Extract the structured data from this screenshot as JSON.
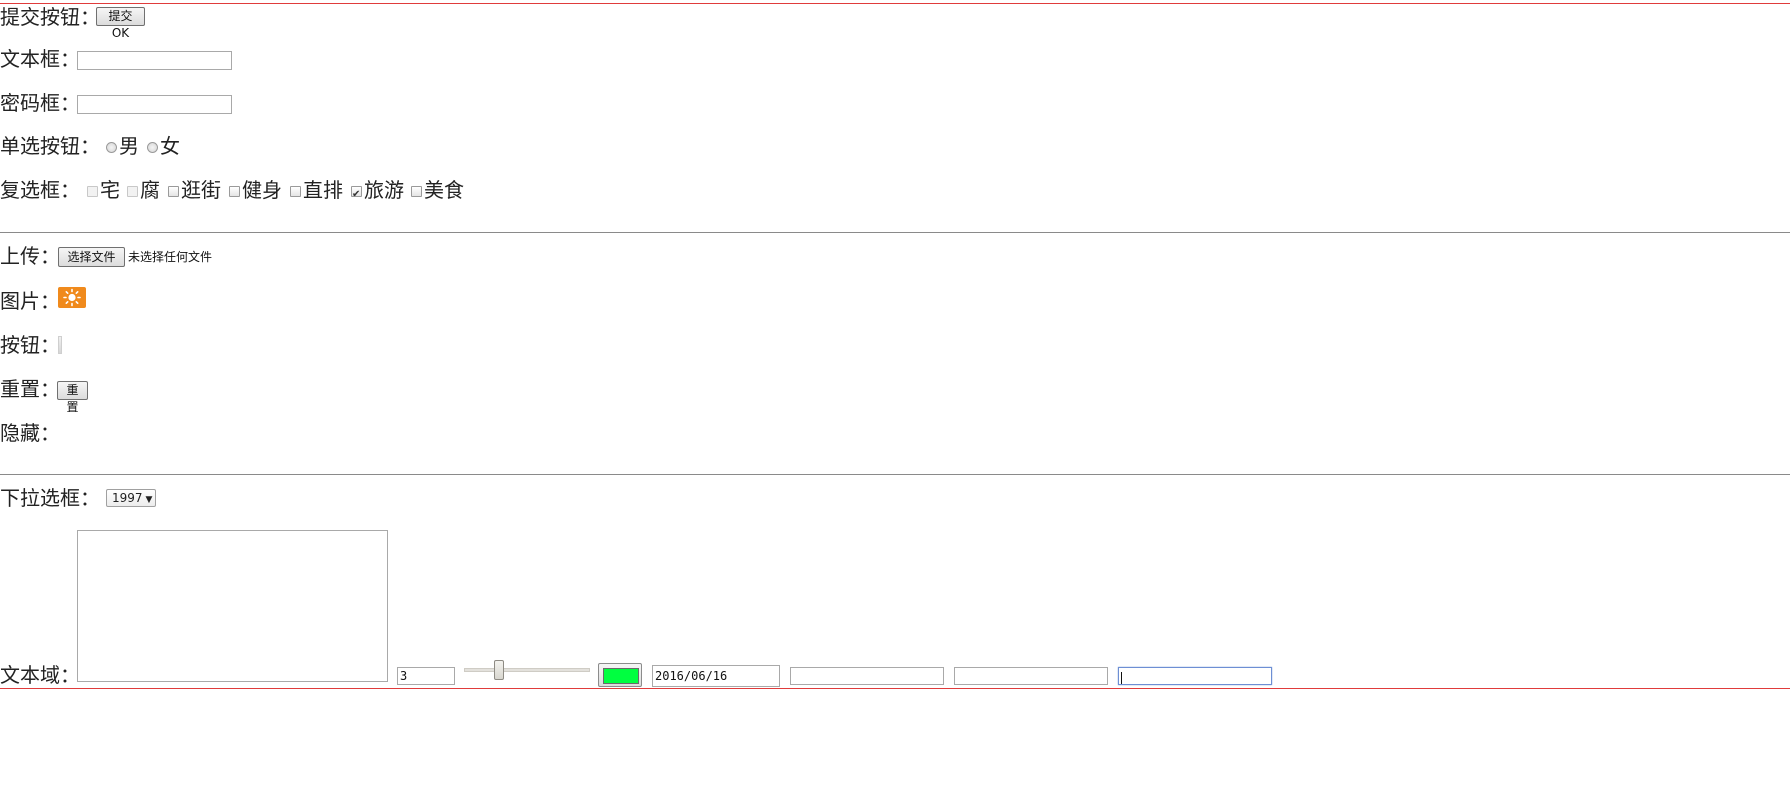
{
  "form": {
    "submit": {
      "label": "提交按钮：",
      "button_text": "提交OK"
    },
    "text_field": {
      "label": "文本框：",
      "value": ""
    },
    "password_field": {
      "label": "密码框：",
      "value": ""
    },
    "radio_group": {
      "label": "单选按钮：",
      "options": [
        {
          "text": "男",
          "checked": false
        },
        {
          "text": "女",
          "checked": false
        }
      ]
    },
    "checkbox_group": {
      "label": "复选框：",
      "options": [
        {
          "text": "宅",
          "checked": false,
          "disabled": true
        },
        {
          "text": "腐",
          "checked": false,
          "disabled": true
        },
        {
          "text": "逛街",
          "checked": false,
          "disabled": false
        },
        {
          "text": "健身",
          "checked": false,
          "disabled": false
        },
        {
          "text": "直排",
          "checked": false,
          "disabled": false
        },
        {
          "text": "旅游",
          "checked": true,
          "disabled": false
        },
        {
          "text": "美食",
          "checked": false,
          "disabled": false
        }
      ]
    },
    "upload": {
      "label": "上传：",
      "button_text": "选择文件",
      "status": "未选择任何文件"
    },
    "image": {
      "label": "图片：",
      "icon": "sun-icon",
      "color": "#f08a1c"
    },
    "button": {
      "label": "按钮："
    },
    "reset": {
      "label": "重置：",
      "button_text": "重置"
    },
    "hidden": {
      "label": "隐藏："
    },
    "select": {
      "label": "下拉选框：",
      "value": "1997"
    },
    "textarea": {
      "label": "文本域："
    },
    "number_input": {
      "value": "3"
    },
    "range": {
      "value_fraction": 0.26
    },
    "color_input": {
      "value": "#00ff40"
    },
    "date_input": {
      "value": "2016/06/16"
    },
    "extra_input_1": {
      "value": ""
    },
    "extra_input_2": {
      "value": ""
    },
    "extra_input_3": {
      "value": ""
    }
  },
  "colors": {
    "divider_red": "#e03b3b",
    "divider_gray": "#8a8a8a",
    "focus_border": "#6d8fd4"
  }
}
